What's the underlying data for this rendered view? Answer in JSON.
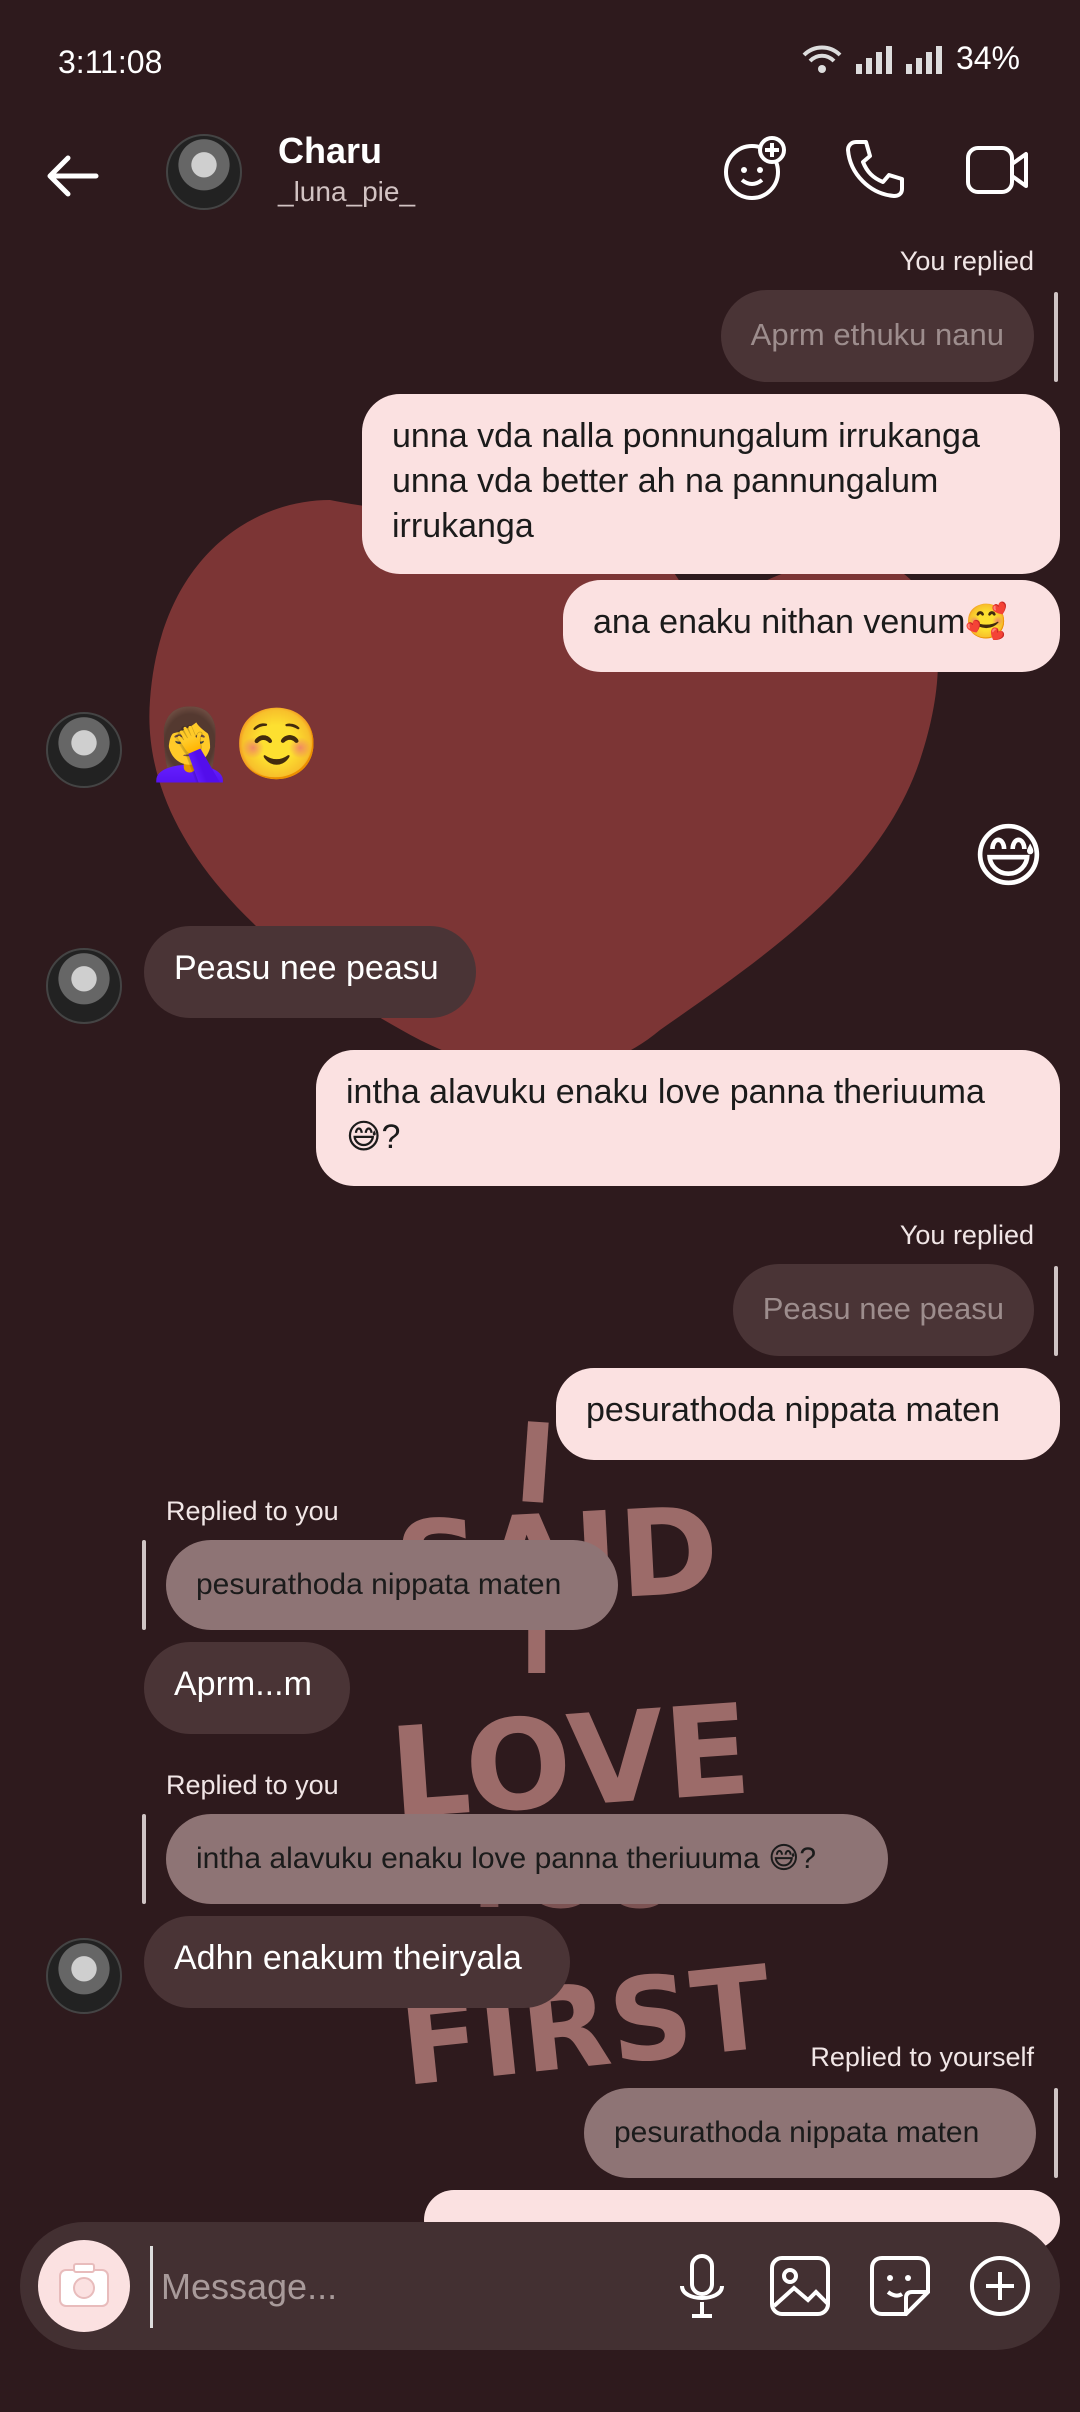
{
  "status_bar": {
    "time": "3:11:08",
    "battery": "34%"
  },
  "header": {
    "name": "Charu",
    "username": "_luna_pie_"
  },
  "messages": [
    {
      "kind": "label",
      "text": "You replied"
    },
    {
      "kind": "quoted_me",
      "text": "Aprm ethuku nanu"
    },
    {
      "kind": "me",
      "text": "unna vda nalla ponnungalum irrukanga unna vda better ah na pannungalum irrukanga"
    },
    {
      "kind": "me",
      "text": "ana enaku nithan venum🥰"
    },
    {
      "kind": "them_emoji",
      "text": "🤦‍♀️☺️"
    },
    {
      "kind": "me_emoji",
      "text": "😅"
    },
    {
      "kind": "them",
      "text": "Peasu nee peasu"
    },
    {
      "kind": "me",
      "text": "intha alavuku enaku love panna theriuuma 😅?"
    },
    {
      "kind": "label",
      "text": "You replied"
    },
    {
      "kind": "quoted_me",
      "text": "Peasu nee peasu"
    },
    {
      "kind": "me",
      "text": "pesurathoda nippata maten"
    },
    {
      "kind": "label",
      "text": "Replied to you"
    },
    {
      "kind": "quoted_them",
      "text": "pesurathoda nippata maten"
    },
    {
      "kind": "them",
      "text": "Aprm...m"
    },
    {
      "kind": "label",
      "text": "Replied to you"
    },
    {
      "kind": "quoted_them",
      "text": "intha alavuku enaku love panna theriuuma 😅?"
    },
    {
      "kind": "them",
      "text": "Adhn enakum theiryala"
    },
    {
      "kind": "label",
      "text": "Replied to yourself"
    },
    {
      "kind": "quoted_them",
      "text": "pesurathoda nippata maten"
    }
  ],
  "background_art": {
    "words": [
      "I",
      "SAID",
      "I",
      "LOVE",
      "YOU",
      "FIRST"
    ],
    "heart_color": "#8a3b3a"
  },
  "composer": {
    "placeholder": "Message..."
  },
  "icons": {
    "back": "arrow-left-icon",
    "sticker_add": "sticker-plus-icon",
    "call": "phone-icon",
    "video": "video-camera-icon",
    "camera": "camera-icon",
    "mic": "microphone-icon",
    "gallery": "image-icon",
    "sticker": "sticker-icon",
    "more": "plus-circle-icon"
  },
  "colors": {
    "background": "#2e1a1d",
    "my_bubble": "#fbe1e1",
    "their_bubble": "#4a3436"
  }
}
